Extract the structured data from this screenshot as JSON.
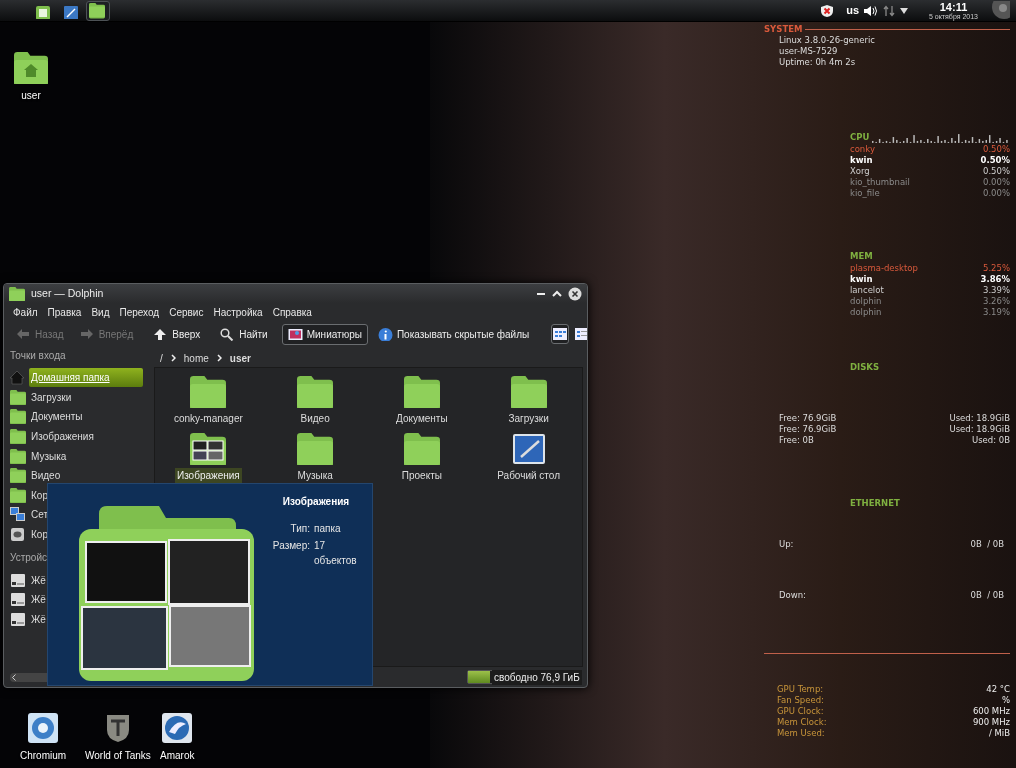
{
  "panel": {
    "launchers": [
      {
        "kind": "mint"
      },
      {
        "kind": "desktop"
      },
      {
        "kind": "folder",
        "selected": true
      }
    ],
    "layout": "us",
    "clock": "14:11",
    "date": "5 октября 2013"
  },
  "desktop_icons": [
    {
      "label": "user",
      "kind": "home"
    },
    {
      "label": "Chromium",
      "kind": "chromium"
    },
    {
      "label": "World of Tanks",
      "kind": "tanks"
    },
    {
      "label": "Amarok",
      "kind": "amarok"
    }
  ],
  "conky": {
    "sections": [
      {
        "kind": "system",
        "title": "SYSTEM",
        "lines": [
          "Linux 3.8.0-26-generic",
          "user-MS-7529",
          "Uptime: 0h 4m 2s"
        ]
      },
      {
        "kind": "top",
        "title": "CPU",
        "rows": [
          {
            "name": "conky",
            "value": "0.50%"
          },
          {
            "name": "kwin",
            "value": "0.50%"
          },
          {
            "name": "Xorg",
            "value": "0.50%"
          },
          {
            "name": "kio_thumbnail",
            "value": "0.00%"
          },
          {
            "name": "kio_file",
            "value": "0.00%"
          }
        ]
      },
      {
        "kind": "top",
        "title": "MEM",
        "rows": [
          {
            "name": "plasma-desktop",
            "value": "5.25%"
          },
          {
            "name": "kwin",
            "value": "3.86%"
          },
          {
            "name": "lancelot",
            "value": "3.39%"
          },
          {
            "name": "dolphin",
            "value": "3.26%"
          },
          {
            "name": "dolphin",
            "value": "3.19%"
          }
        ]
      },
      {
        "kind": "disks",
        "title": "DISKS",
        "rows": [
          {
            "free": "Free: 76.9GiB",
            "used": "Used: 18.9GiB"
          },
          {
            "free": "Free: 76.9GiB",
            "used": "Used: 18.9GiB"
          },
          {
            "free": "Free: 0B",
            "used": "Used: 0B"
          }
        ]
      },
      {
        "kind": "net",
        "title": "ETHERNET",
        "rows": [
          {
            "label": "Up:",
            "value": "0B  / 0B"
          },
          {
            "label": "Down:",
            "value": "0B  / 0B"
          }
        ]
      },
      {
        "kind": "gpu",
        "rows": [
          {
            "label": "GPU Temp:",
            "value": "42 °C"
          },
          {
            "label": "Fan Speed:",
            "value": "%"
          },
          {
            "label": "GPU Clock:",
            "value": "600 MHz"
          },
          {
            "label": "Mem Clock:",
            "value": "900 MHz"
          },
          {
            "label": "Mem Used:",
            "value": "/  MiB"
          }
        ]
      }
    ]
  },
  "dolphin": {
    "title": "user — Dolphin",
    "menu": [
      "Файл",
      "Правка",
      "Вид",
      "Переход",
      "Сервис",
      "Настройка",
      "Справка"
    ],
    "toolbar": [
      {
        "kind": "back",
        "label": "Назад",
        "disabled": true
      },
      {
        "kind": "forward",
        "label": "Вперёд",
        "disabled": true
      },
      {
        "kind": "up",
        "label": "Вверх",
        "disabled": false
      },
      {
        "kind": "find",
        "label": "Найти",
        "disabled": false
      },
      {
        "kind": "preview",
        "label": "Миниатюры",
        "disabled": false,
        "checked": true
      },
      {
        "kind": "hidden",
        "label": "Показывать скрытые файлы",
        "disabled": false,
        "checked": false
      }
    ],
    "view_modes": [
      {
        "kind": "icons",
        "selected": true
      },
      {
        "kind": "details",
        "selected": false
      }
    ],
    "breadcrumb": [
      "/",
      "home",
      "user"
    ],
    "places_header": "Точки входа",
    "places": [
      {
        "kind": "home",
        "label": "Домашняя папка",
        "selected": true
      },
      {
        "kind": "folder",
        "label": "Загрузки",
        "selected": false
      },
      {
        "kind": "folder",
        "label": "Документы",
        "selected": false
      },
      {
        "kind": "folder",
        "label": "Изображения",
        "selected": false
      },
      {
        "kind": "folder",
        "label": "Музыка",
        "selected": false
      },
      {
        "kind": "folder",
        "label": "Видео",
        "selected": false
      },
      {
        "kind": "folder",
        "label": "Кор",
        "selected": false
      },
      {
        "kind": "network",
        "label": "Сет",
        "selected": false
      },
      {
        "kind": "trash",
        "label": "Кор",
        "selected": false
      }
    ],
    "devices_header": "Устройс",
    "devices": [
      {
        "label": "Жё",
        "selected": false
      },
      {
        "label": "Жё",
        "selected": false
      },
      {
        "label": "Жё",
        "selected": false
      }
    ],
    "files": [
      {
        "kind": "folder",
        "name": "conky-manager",
        "selected": false
      },
      {
        "kind": "folder",
        "name": "Видео",
        "selected": false
      },
      {
        "kind": "folder",
        "name": "Документы",
        "selected": false
      },
      {
        "kind": "folder",
        "name": "Загрузки",
        "selected": false
      },
      {
        "kind": "images",
        "name": "Изображения",
        "selected": true
      },
      {
        "kind": "folder",
        "name": "Музыка",
        "selected": false
      },
      {
        "kind": "folder",
        "name": "Проекты",
        "selected": false
      },
      {
        "kind": "desktop",
        "name": "Рабочий стол",
        "selected": false
      }
    ],
    "status": {
      "free": "свободно 76,9 ГиБ",
      "level": 0.2
    }
  },
  "tooltip": {
    "title": "Изображения",
    "fields": [
      {
        "label": "Тип:",
        "value": "папка"
      },
      {
        "label": "Размер:",
        "value": "17 объектов"
      }
    ]
  }
}
